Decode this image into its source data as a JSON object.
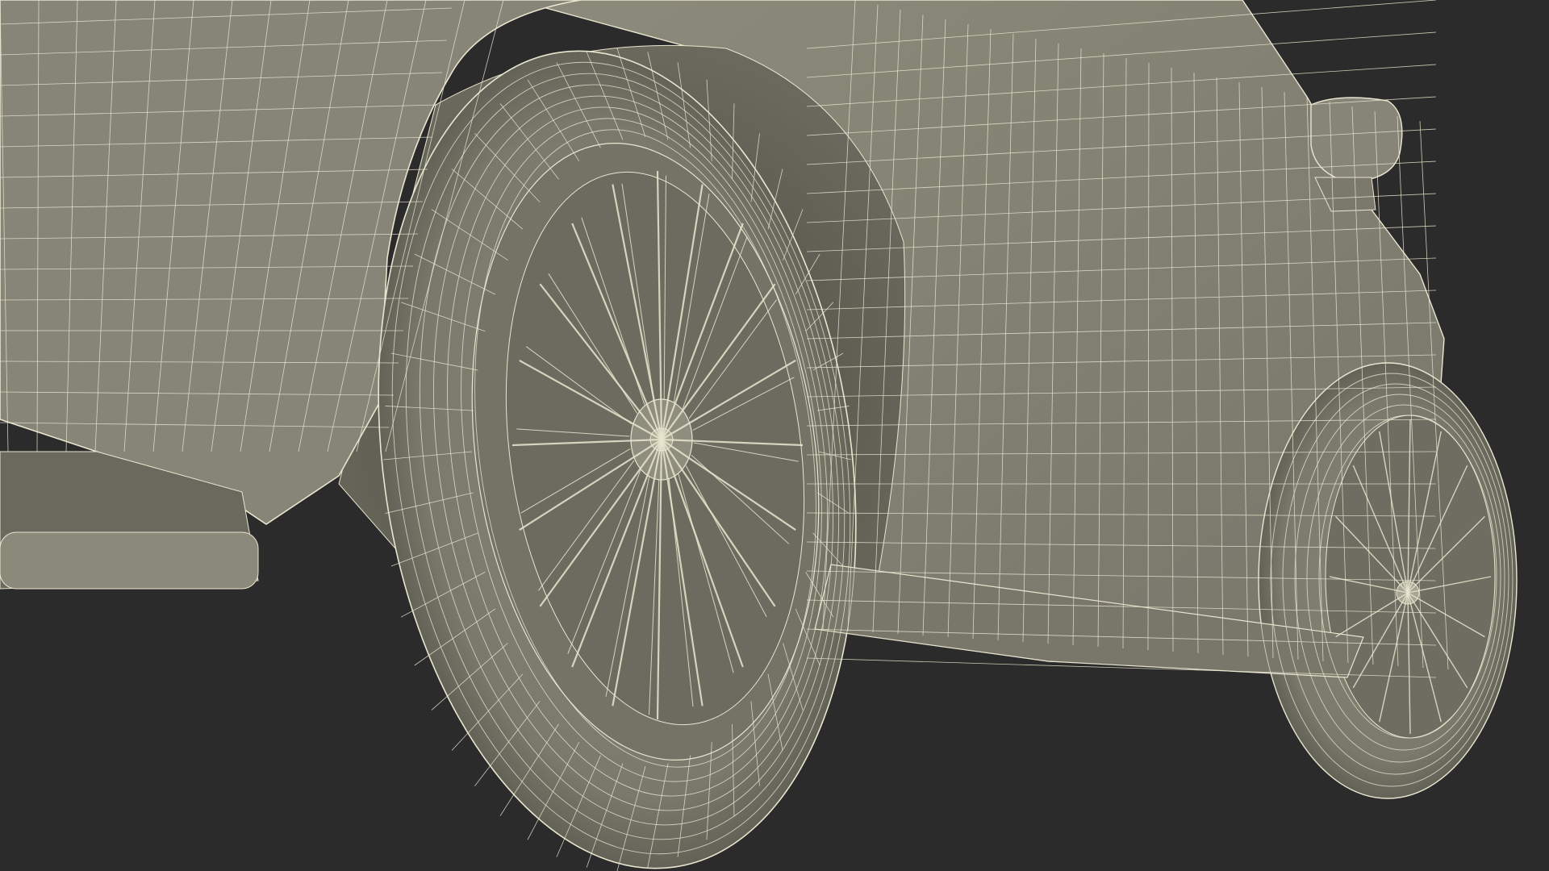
{
  "viewport": {
    "background": "#2b2b2b",
    "model_fill": "#7d7c6d",
    "model_fill_light": "#8b8a7a",
    "model_fill_dark": "#5e5d52",
    "wire_color": "#e9e6cf"
  }
}
